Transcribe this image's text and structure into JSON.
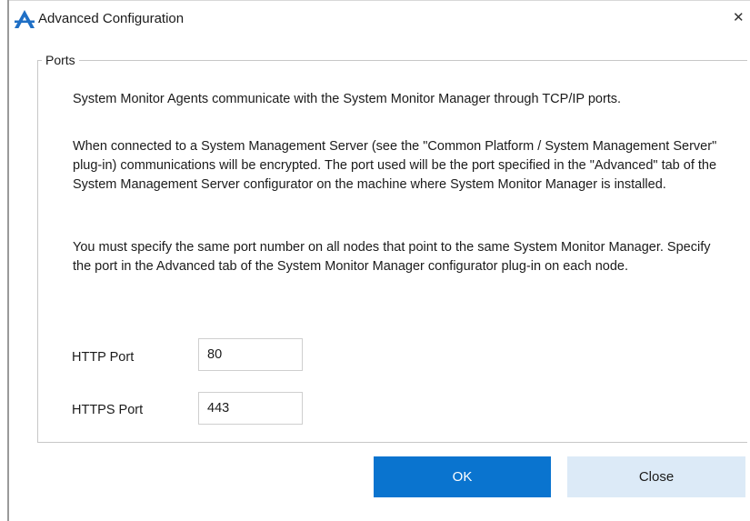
{
  "window": {
    "title": "Advanced Configuration",
    "close_glyph": "✕",
    "logo_icon": "app-logo-icon",
    "accent_color": "#0a74cf"
  },
  "group": {
    "legend": "Ports",
    "paragraphs": [
      "System Monitor Agents communicate with the System Monitor Manager through TCP/IP ports.",
      "When connected to a System Management Server (see the \"Common Platform / System Management Server\" plug-in) communications will be encrypted. The port used will be the port specified in the \"Advanced\" tab of the System Management Server configurator on the machine where System Monitor Manager is installed.",
      "You must specify the same port number on all nodes that point to the same System Monitor Manager. Specify the port in the Advanced tab of the System Monitor Manager configurator plug-in on each node."
    ],
    "fields": {
      "http_label": "HTTP Port",
      "http_value": "80",
      "https_label": "HTTPS Port",
      "https_value": "443"
    }
  },
  "buttons": {
    "ok_label": "OK",
    "close_label": "Close",
    "ok_color": "#0a74cf",
    "close_color": "#dceaf7"
  }
}
